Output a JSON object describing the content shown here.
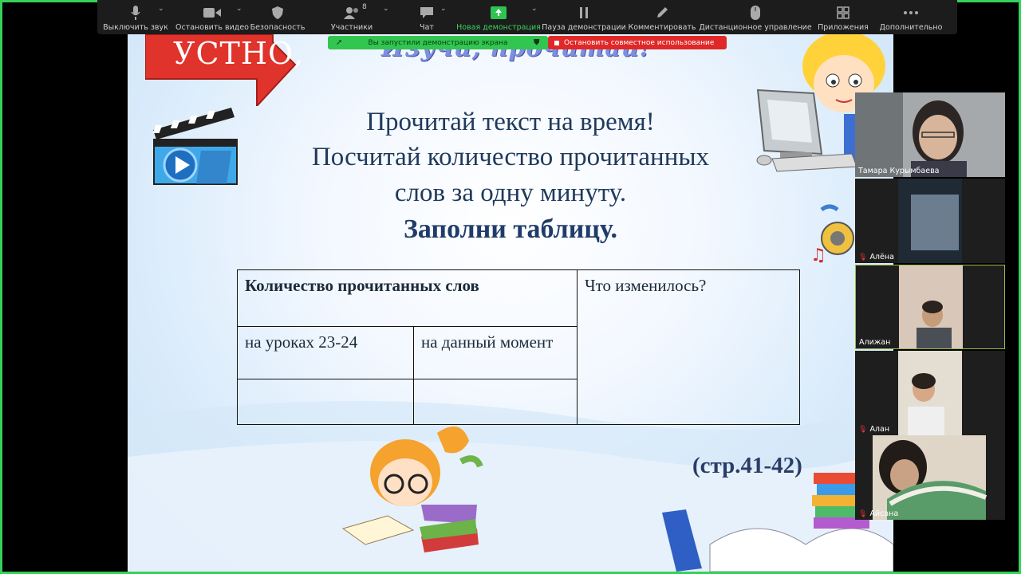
{
  "toolbar": {
    "items": [
      {
        "label": "Выключить звук",
        "icon": "microphone-icon"
      },
      {
        "label": "Остановить видео",
        "icon": "video-camera-icon"
      },
      {
        "label": "Безопасность",
        "icon": "shield-icon"
      },
      {
        "label": "Участники",
        "icon": "participants-icon",
        "count": "8"
      },
      {
        "label": "Чат",
        "icon": "chat-icon"
      },
      {
        "label": "Новая демонстрация",
        "icon": "share-screen-icon"
      },
      {
        "label": "Пауза демонстрации",
        "icon": "pause-icon"
      },
      {
        "label": "Комментировать",
        "icon": "pencil-icon"
      },
      {
        "label": "Дистанционное управление",
        "icon": "mouse-icon"
      },
      {
        "label": "Приложения",
        "icon": "apps-icon"
      },
      {
        "label": "Дополнительно",
        "icon": "more-icon"
      }
    ]
  },
  "banners": {
    "sharing": "Вы запустили демонстрацию экрана",
    "stop": "Остановить совместное использование"
  },
  "slide": {
    "badge": "УСТНО,",
    "title": "Изучи, прочитай!",
    "line1": "Прочитай текст на время!",
    "line2": "Посчитай количество прочитанных",
    "line3": "слов за одну минуту.",
    "line4": "Заполни таблицу.",
    "table": {
      "header": "Количество прочитанных слов",
      "changed": "Что изменилось?",
      "col1": "на уроках 23-24",
      "col2": "на данный момент"
    },
    "page_ref": "(стр.41-42)"
  },
  "participants": [
    {
      "name": "Тамара Курымбаева",
      "muted": false
    },
    {
      "name": "Алёна",
      "muted": true
    },
    {
      "name": "Алижан",
      "muted": false
    },
    {
      "name": "Алан",
      "muted": true
    },
    {
      "name": "Айсана",
      "muted": true
    }
  ],
  "colors": {
    "accent_green": "#37d05a",
    "stop_red": "#e02828",
    "toolbar_bg": "#1c1c1c"
  }
}
